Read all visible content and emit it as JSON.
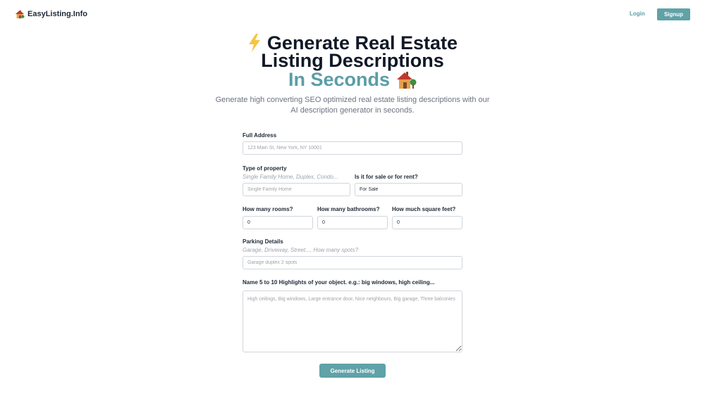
{
  "header": {
    "brand": "EasyListing.Info",
    "brand_icon": "house-icon",
    "login": "Login",
    "signup": "Signup"
  },
  "hero": {
    "line1": "Generate Real Estate",
    "line2": "Listing Descriptions",
    "line3": "In Seconds",
    "subtitle": "Generate high converting SEO optimized real estate listing descriptions with our AI description generator in seconds.",
    "bolt_icon": "lightning-bolt-icon",
    "house_icon": "house-with-tree-icon"
  },
  "form": {
    "address": {
      "label": "Full Address",
      "placeholder": "123 Main St, New York, NY 10001"
    },
    "property_type": {
      "label": "Type of property",
      "hint": "Single Family Home, Duplex, Condo...",
      "placeholder": "Single Family Home"
    },
    "sale_rent": {
      "label": "Is it for sale or for rent?",
      "value": "For Sale"
    },
    "rooms": {
      "label": "How many rooms?",
      "value": "0"
    },
    "bathrooms": {
      "label": "How many bathrooms?",
      "value": "0"
    },
    "sqft": {
      "label": "How much square feet?",
      "value": "0"
    },
    "parking": {
      "label": "Parking Details",
      "hint": "Garage, Driveway, Street..., How many spots?",
      "placeholder": "Garage duplex 2 spots"
    },
    "highlights": {
      "label": "Name 5 to 10 Highlights of your object. e.g.: big windows, high ceiling...",
      "placeholder": "High ceilings, Big windows, Large entrance door, Nice neighbours, Big garage, Three balconies"
    },
    "submit": "Generate Listing"
  },
  "colors": {
    "accent": "#5fa2a8",
    "heading": "#111827",
    "muted": "#6b7280"
  }
}
